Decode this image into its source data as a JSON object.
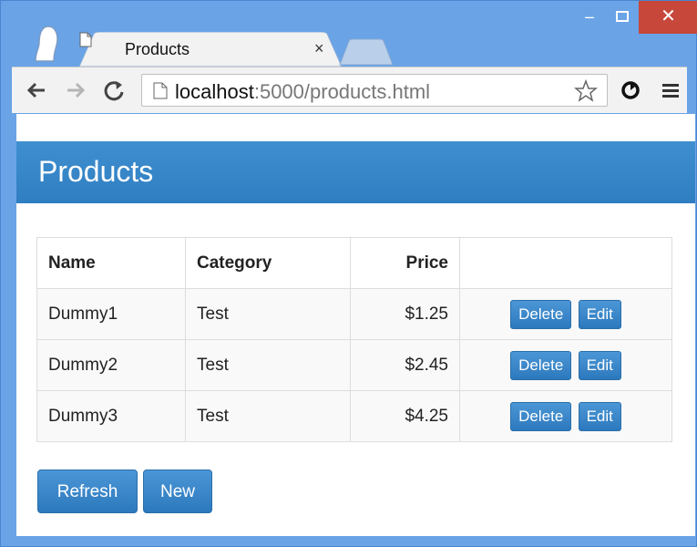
{
  "tab": {
    "title": "Products",
    "close": "×"
  },
  "window": {
    "minimize": "–",
    "close": "✕"
  },
  "address_bar": {
    "host": "localhost",
    "rest": ":5000/products.html"
  },
  "page": {
    "title": "Products",
    "table": {
      "headers": [
        "Name",
        "Category",
        "Price"
      ],
      "rows": [
        {
          "name": "Dummy1",
          "category": "Test",
          "price": "$1.25",
          "delete": "Delete",
          "edit": "Edit"
        },
        {
          "name": "Dummy2",
          "category": "Test",
          "price": "$2.45",
          "delete": "Delete",
          "edit": "Edit"
        },
        {
          "name": "Dummy3",
          "category": "Test",
          "price": "$4.25",
          "delete": "Delete",
          "edit": "Edit"
        }
      ]
    },
    "buttons": {
      "refresh": "Refresh",
      "new": "New"
    }
  },
  "colors": {
    "frame": "#6aa3e6",
    "accent": "#2f7ec1",
    "close_button": "#c7473b"
  },
  "icons": [
    "profile-avatar-icon",
    "document-icon",
    "back-arrow-icon",
    "forward-arrow-icon",
    "reload-icon",
    "star-icon",
    "extension-icon",
    "menu-icon"
  ]
}
